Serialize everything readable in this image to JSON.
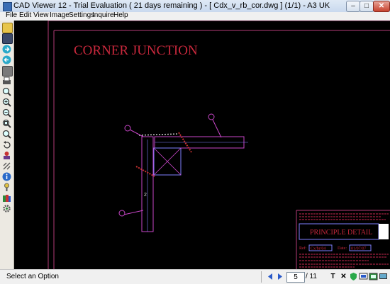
{
  "window": {
    "title": "CAD Viewer 12 - Trial Evaluation ( 21 days remaining )  -  [ Cdx_v_rb_cor.dwg ] (1/1)  -  A3 UK",
    "minimize_glyph": "–",
    "maximize_glyph": "□",
    "close_glyph": "✕"
  },
  "menu": {
    "file": "File",
    "edit": "Edit",
    "view": "View",
    "image": "Image",
    "settings": "Settings",
    "inquire": "Inquire",
    "help": "Help"
  },
  "toolbar": {
    "icons": [
      "open-folder-icon",
      "save-icon",
      "forward-icon",
      "back-icon",
      "layers-icon",
      "print-icon",
      "zoom-icon",
      "zoom-in-icon",
      "zoom-out-icon",
      "zoom-window-icon",
      "zoom-extents-icon",
      "undo-icon",
      "transform-icon",
      "scale-icon",
      "info-icon",
      "question-icon",
      "books-icon",
      "settings-icon"
    ]
  },
  "drawing": {
    "heading": "CORNER JUNCTION",
    "detail_title": "PRINCIPLE DETAIL",
    "ref_label": "Ref:",
    "ref_value": "Cx/br/04",
    "date_label": "Date:",
    "date_value": "01/07/07",
    "dimension_label": "2",
    "colors": {
      "heading": "#c8283c",
      "frame": "#b43c78",
      "lines": "#c846c8",
      "detail": "#8080ff"
    }
  },
  "status": {
    "text": "Select an Option",
    "current_page": "5",
    "page_total": "/ 11",
    "text_tool": "T",
    "delete_tool": "✕"
  }
}
